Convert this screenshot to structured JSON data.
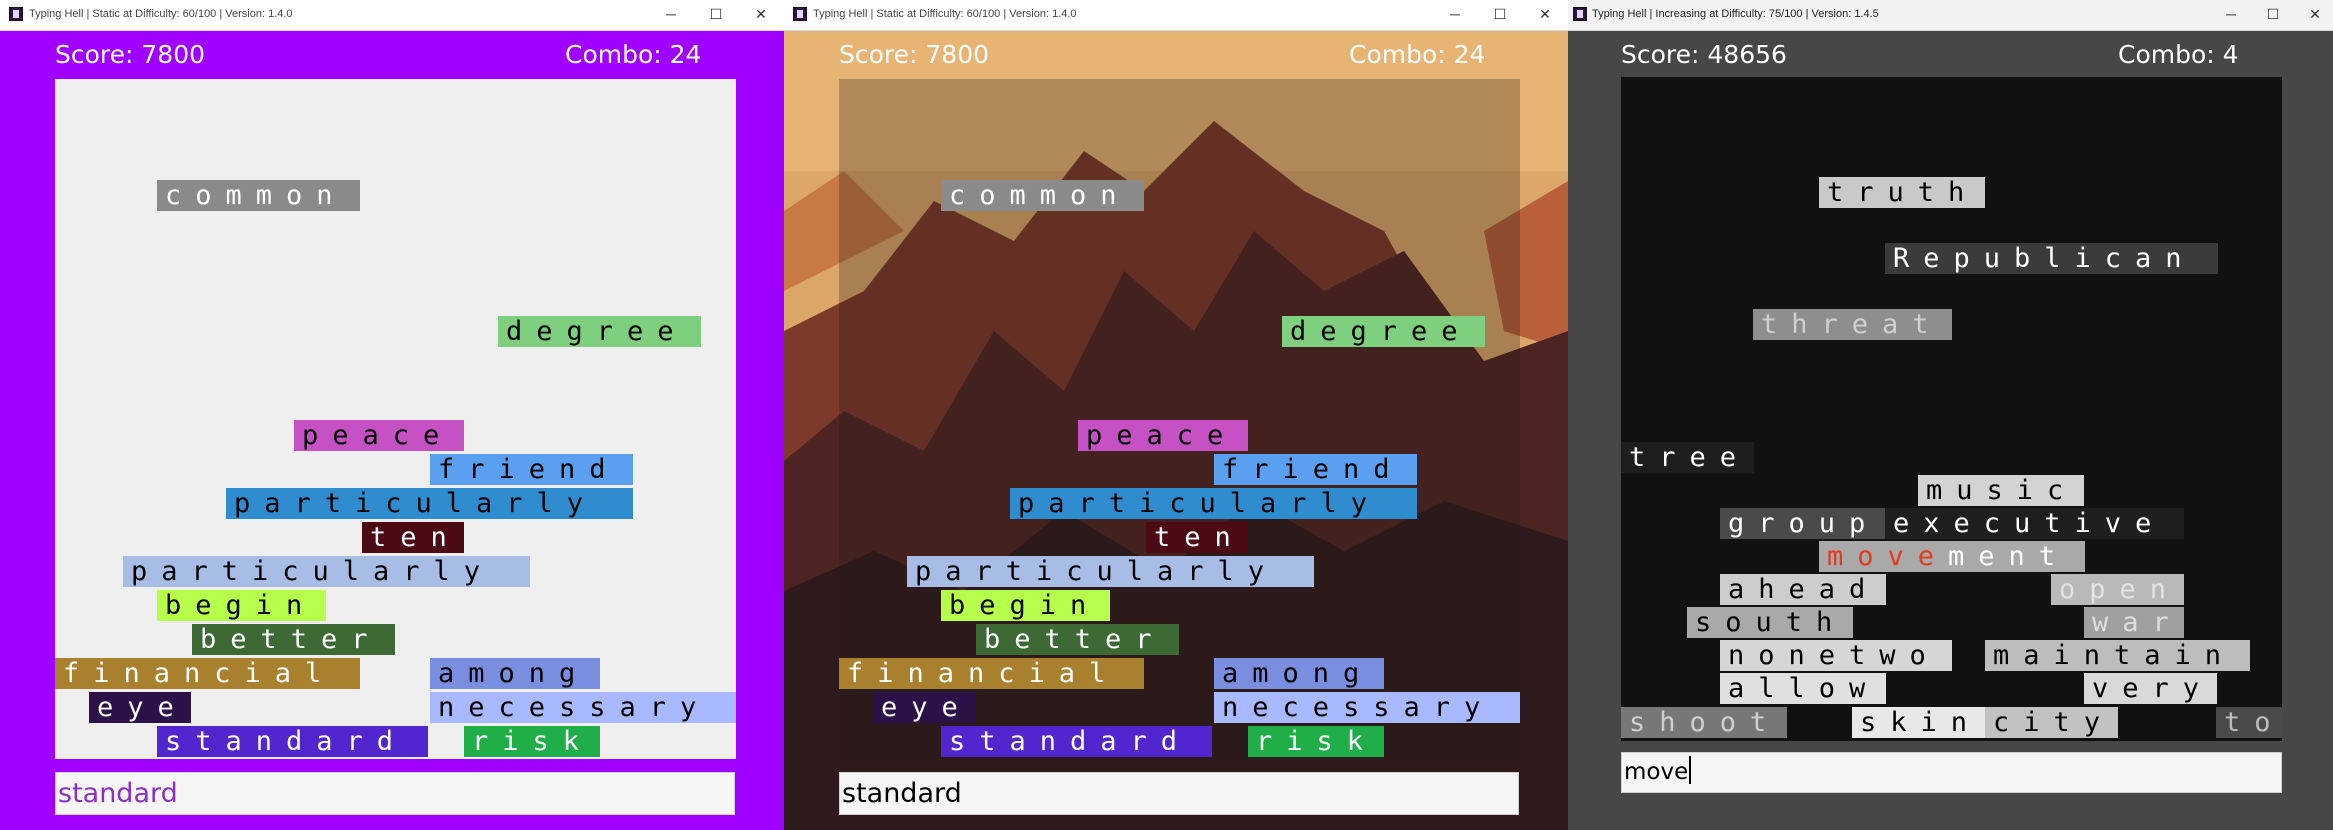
{
  "windows": [
    {
      "title": "Typing Hell | Static at Difficulty: 60/100 | Version: 1.4.0",
      "theme": {
        "frame": "#a000ff",
        "field": "#efefef",
        "hud": "#ffffff",
        "input_text": "#8b2fc9"
      },
      "background_icon": "none",
      "score": "Score: 7800",
      "combo": "Combo: 24",
      "input": "standard",
      "words": [
        {
          "text": "common",
          "color": "#8a8a8a",
          "light": true
        },
        {
          "text": "degree",
          "color": "#7ed07e"
        },
        {
          "text": "peace",
          "color": "#c551c5"
        },
        {
          "text": "friend",
          "color": "#5b9ff0"
        },
        {
          "text": "particularly",
          "color": "#2f8ccf"
        },
        {
          "text": "ten",
          "color": "#4b0a14",
          "light": true
        },
        {
          "text": "particularly",
          "color": "#a7bde6"
        },
        {
          "text": "begin",
          "color": "#b6ff4a"
        },
        {
          "text": "better",
          "color": "#3d6a34",
          "light": true
        },
        {
          "text": "financial",
          "color": "#a9812e",
          "light": true
        },
        {
          "text": "among",
          "color": "#7a8ee0"
        },
        {
          "text": "eye",
          "color": "#2b1148",
          "light": true
        },
        {
          "text": "necessary",
          "color": "#a9b9ff"
        },
        {
          "text": "standard",
          "color": "#5126cf",
          "light": true
        },
        {
          "text": "risk",
          "color": "#1fae47",
          "light": true
        }
      ]
    },
    {
      "title": "Typing Hell | Static at Difficulty: 60/100 | Version: 1.4.0",
      "theme": {
        "frame": "#dba869",
        "field": "#3a2a28",
        "hud": "#ffffff",
        "input_text": "#000000"
      },
      "background_icon": "mountain-landscape",
      "score": "Score: 7800",
      "combo": "Combo: 24",
      "input": "standard",
      "words": [
        {
          "text": "common",
          "color": "#8a8a8a",
          "light": true
        },
        {
          "text": "degree",
          "color": "#7ed07e"
        },
        {
          "text": "peace",
          "color": "#c551c5"
        },
        {
          "text": "friend",
          "color": "#5b9ff0"
        },
        {
          "text": "particularly",
          "color": "#2f8ccf"
        },
        {
          "text": "ten",
          "color": "#4b0a14",
          "light": true
        },
        {
          "text": "particularly",
          "color": "#a7bde6"
        },
        {
          "text": "begin",
          "color": "#b6ff4a"
        },
        {
          "text": "better",
          "color": "#3d6a34",
          "light": true
        },
        {
          "text": "financial",
          "color": "#a9812e",
          "light": true
        },
        {
          "text": "among",
          "color": "#7a8ee0"
        },
        {
          "text": "eye",
          "color": "#2b1148",
          "light": true
        },
        {
          "text": "necessary",
          "color": "#a9b9ff"
        },
        {
          "text": "standard",
          "color": "#5126cf",
          "light": true
        },
        {
          "text": "risk",
          "color": "#1fae47",
          "light": true
        }
      ]
    },
    {
      "title": "Typing Hell | Increasing at Difficulty: 75/100 | Version: 1.4.5",
      "theme": {
        "frame": "#474747",
        "field": "#111111",
        "hud": "#ffffff",
        "input_text": "#000000"
      },
      "background_icon": "none",
      "score": "Score: 48656",
      "combo": "Combo: 4",
      "input": "move",
      "words": [
        {
          "text": "truth",
          "color": "#c9c9c9"
        },
        {
          "text": "Republican",
          "color": "#3b3b3b",
          "light": true
        },
        {
          "text": "threat",
          "color": "#8e8e8e",
          "faded": true
        },
        {
          "text": "tree",
          "color": "#1e1e1e",
          "light": true
        },
        {
          "text": "music",
          "color": "#d3d3d3"
        },
        {
          "text": "group",
          "color": "#4a4a4a",
          "light": true
        },
        {
          "text": "executive",
          "color": "#1f1f1f",
          "light": true
        },
        {
          "text": "movement",
          "color": "#a9a9a9",
          "light": true,
          "typed": "move"
        },
        {
          "text": "ahead",
          "color": "#cdcdcd"
        },
        {
          "text": "open",
          "color": "#b9b9b9",
          "faded": true
        },
        {
          "text": "south",
          "color": "#a9a9a9"
        },
        {
          "text": "war",
          "color": "#a0a0a0",
          "faded": true
        },
        {
          "text": "nonetwo",
          "color": "#d6d6d6"
        },
        {
          "text": "maintain",
          "color": "#bdbdbd"
        },
        {
          "text": "allow",
          "color": "#e0e0e0"
        },
        {
          "text": "very",
          "color": "#d9d9d9"
        },
        {
          "text": "shoot",
          "color": "#777777",
          "faded": true
        },
        {
          "text": "skin",
          "color": "#e8e8e8"
        },
        {
          "text": "city",
          "color": "#c2c2c2"
        },
        {
          "text": "to",
          "color": "#4a4a4a",
          "faded": true
        }
      ]
    }
  ]
}
